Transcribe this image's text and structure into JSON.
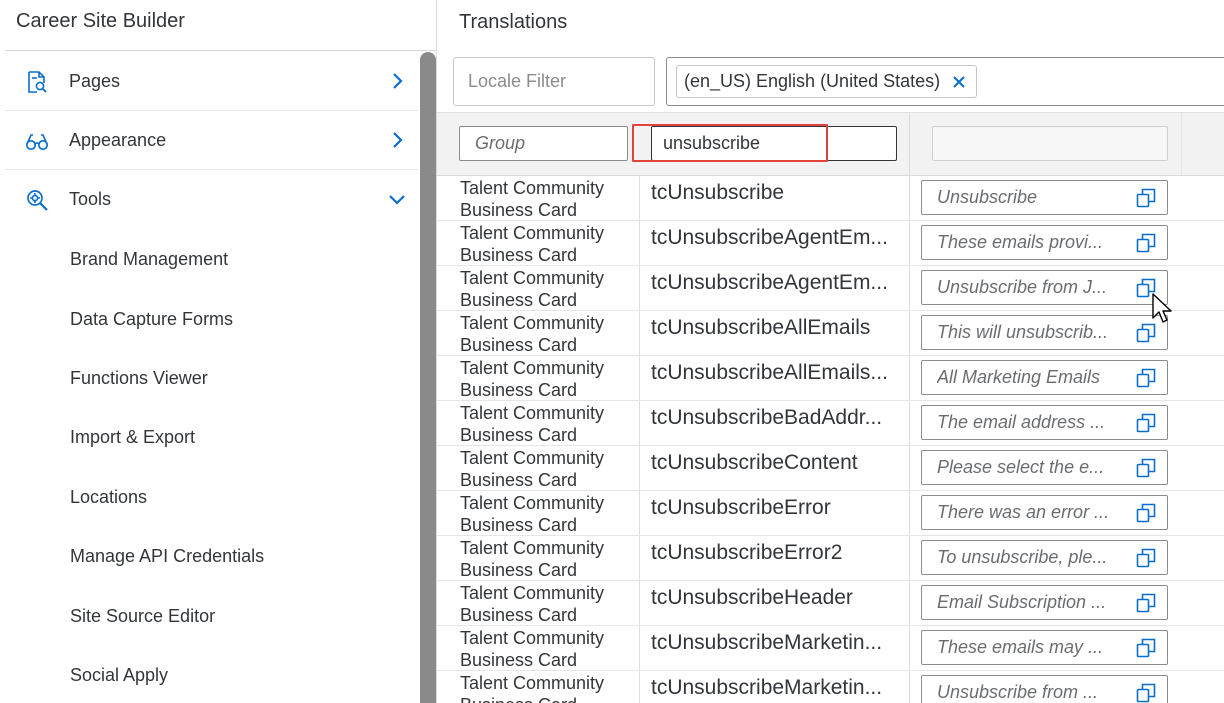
{
  "sidebar": {
    "title": "Career Site Builder",
    "nav": [
      {
        "label": "Pages",
        "icon": "page-search-icon",
        "state": "collapsed"
      },
      {
        "label": "Appearance",
        "icon": "glasses-icon",
        "state": "collapsed"
      },
      {
        "label": "Tools",
        "icon": "zoom-gear-icon",
        "state": "expanded"
      }
    ],
    "tools_items": [
      "Brand Management",
      "Data Capture Forms",
      "Functions Viewer",
      "Import & Export",
      "Locations",
      "Manage API Credentials",
      "Site Source Editor",
      "Social Apply"
    ]
  },
  "main": {
    "title": "Translations",
    "locale_filter_placeholder": "Locale Filter",
    "locale_token": "(en_US) English (United States)",
    "filters": {
      "group_placeholder": "Group",
      "key_value": "unsubscribe",
      "value_value": ""
    },
    "rows": [
      {
        "group": "Talent Community Business Card",
        "key": "tcUnsubscribe",
        "value": "Unsubscribe"
      },
      {
        "group": "Talent Community Business Card",
        "key": "tcUnsubscribeAgentEm...",
        "value": "These emails provi..."
      },
      {
        "group": "Talent Community Business Card",
        "key": "tcUnsubscribeAgentEm...",
        "value": "Unsubscribe from J..."
      },
      {
        "group": "Talent Community Business Card",
        "key": "tcUnsubscribeAllEmails",
        "value": "This will unsubscrib..."
      },
      {
        "group": "Talent Community Business Card",
        "key": "tcUnsubscribeAllEmails...",
        "value": "All Marketing Emails"
      },
      {
        "group": "Talent Community Business Card",
        "key": "tcUnsubscribeBadAddr...",
        "value": "The email address ..."
      },
      {
        "group": "Talent Community Business Card",
        "key": "tcUnsubscribeContent",
        "value": "Please select the e..."
      },
      {
        "group": "Talent Community Business Card",
        "key": "tcUnsubscribeError",
        "value": "There was an error ..."
      },
      {
        "group": "Talent Community Business Card",
        "key": "tcUnsubscribeError2",
        "value": "To unsubscribe, ple..."
      },
      {
        "group": "Talent Community Business Card",
        "key": "tcUnsubscribeHeader",
        "value": "Email Subscription ..."
      },
      {
        "group": "Talent Community Business Card",
        "key": "tcUnsubscribeMarketin...",
        "value": "These emails may ..."
      },
      {
        "group": "Talent Community Business Card",
        "key": "tcUnsubscribeMarketin...",
        "value": "Unsubscribe from ..."
      }
    ]
  },
  "colors": {
    "accent": "#0a6ed1",
    "highlight": "#e0433c",
    "text": "#32363a",
    "placeholder": "#6a6d70"
  }
}
